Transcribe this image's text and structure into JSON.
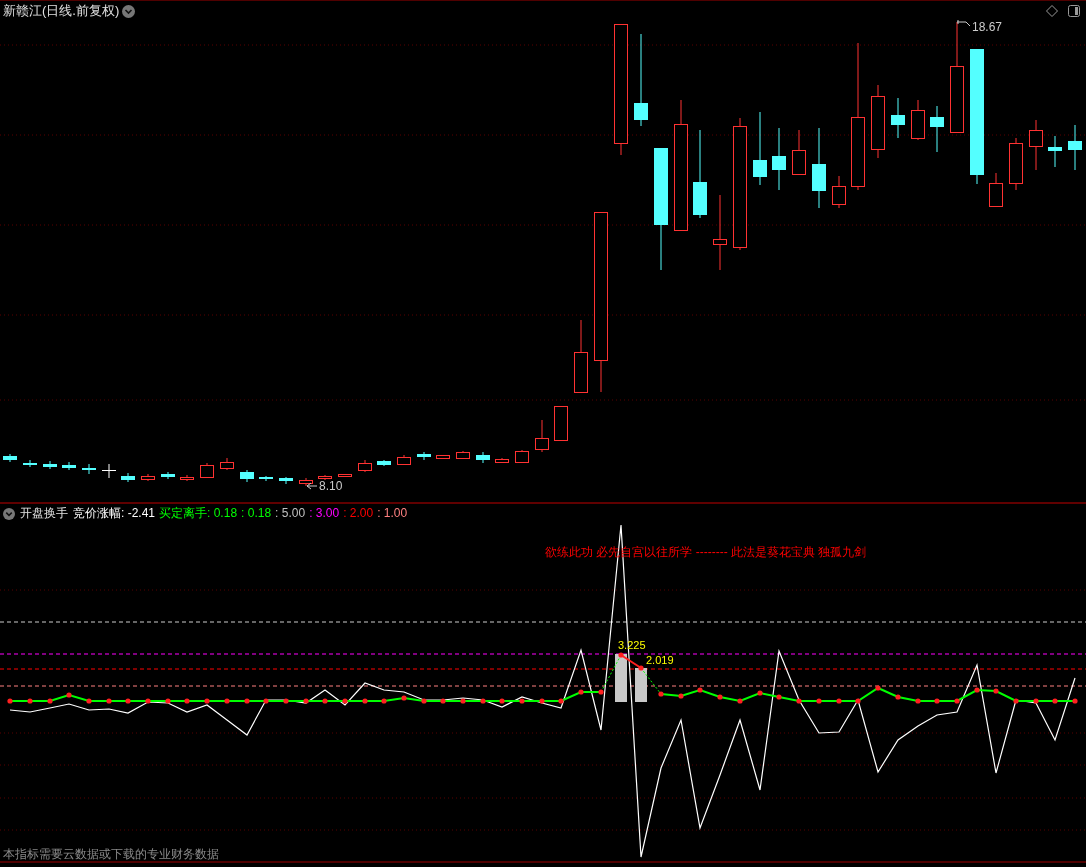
{
  "title": "新赣江(日线.前复权)",
  "price_chart": {
    "high_label": "18.67",
    "low_label": "8.10"
  },
  "indicator": {
    "name": "开盘换手",
    "legend": [
      {
        "text": "竞价涨幅: -2.41",
        "color": "#ffffff"
      },
      {
        "text": "买定离手: 0.18",
        "color": "#00ff00"
      },
      {
        "text": ": 0.18",
        "color": "#00ff00"
      },
      {
        "text": ": 5.00",
        "color": "#c0c0c0"
      },
      {
        "text": ": 3.00",
        "color": "#ff00ff"
      },
      {
        "text": ": 2.00",
        "color": "#ff0000"
      },
      {
        "text": ": 1.00",
        "color": "#ff8080"
      }
    ],
    "annotation": "欲练此功 必先自宫以往所学 -------- 此法是葵花宝典  独孤九剑",
    "bar_labels": [
      "3.225",
      "2.019"
    ]
  },
  "footer_note": "本指标需要云数据或下载的专业财务数据"
}
